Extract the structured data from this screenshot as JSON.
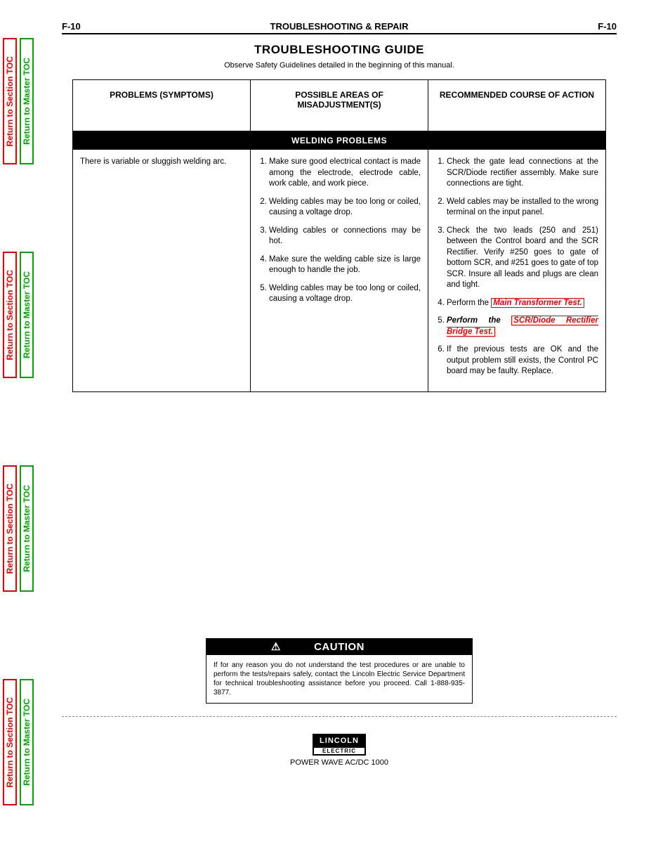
{
  "sideTabs": {
    "section": "Return to Section TOC",
    "master": "Return to Master TOC"
  },
  "header": {
    "left": "F-10",
    "center": "TROUBLESHOOTING & REPAIR",
    "right": "F-10"
  },
  "titles": {
    "section": "TROUBLESHOOTING GUIDE",
    "sub": "Observe Safety Guidelines detailed in the beginning of this manual."
  },
  "table": {
    "head": {
      "c1": "PROBLEMS (SYMPTOMS)",
      "c2": "POSSIBLE AREAS OF MISADJUSTMENT(S)",
      "c3": "RECOMMENDED COURSE OF ACTION"
    },
    "band": "WELDING PROBLEMS",
    "col1": "There is variable or sluggish welding arc.",
    "col2": [
      "Make sure good electrical contact is made among the electrode, electrode cable, work cable, and work piece.",
      "Welding cables may be too long or coiled, causing a voltage drop.",
      "Welding cables or connections may be hot.",
      "Make sure the welding cable size is large enough to handle the job.",
      "Welding cables may be too long or coiled, causing a voltage drop."
    ],
    "col3": {
      "items": [
        "Check the gate lead connections at the SCR/Diode rectifier assembly. Make sure connections are tight.",
        "Weld cables may be installed to the wrong terminal on the input panel.",
        "Check the two leads (250 and 251) between the Control board and the SCR Rectifier. Verify #250 goes to gate of bottom SCR, and #251 goes to gate of top SCR. Insure all leads and plugs are clean and tight.",
        "Perform the"
      ],
      "link1": "Main Transformer Test.",
      "mid": "Perform the ",
      "link2": "SCR/Diode Rectifier Bridge Test.",
      "rest": "If the previous tests are OK and the output problem still exists, the Control PC board may be faulty. Replace."
    }
  },
  "caution": {
    "title": "CAUTION",
    "body": "If for any reason you do not understand the test procedures or are unable to perform the tests/repairs safely, contact the Lincoln Electric Service Department for technical troubleshooting assistance before you proceed. Call 1-888-935-3877."
  },
  "footer": {
    "logoTop": "LINCOLN",
    "logoBot": "ELECTRIC",
    "model": "POWER WAVE AC/DC 1000"
  }
}
